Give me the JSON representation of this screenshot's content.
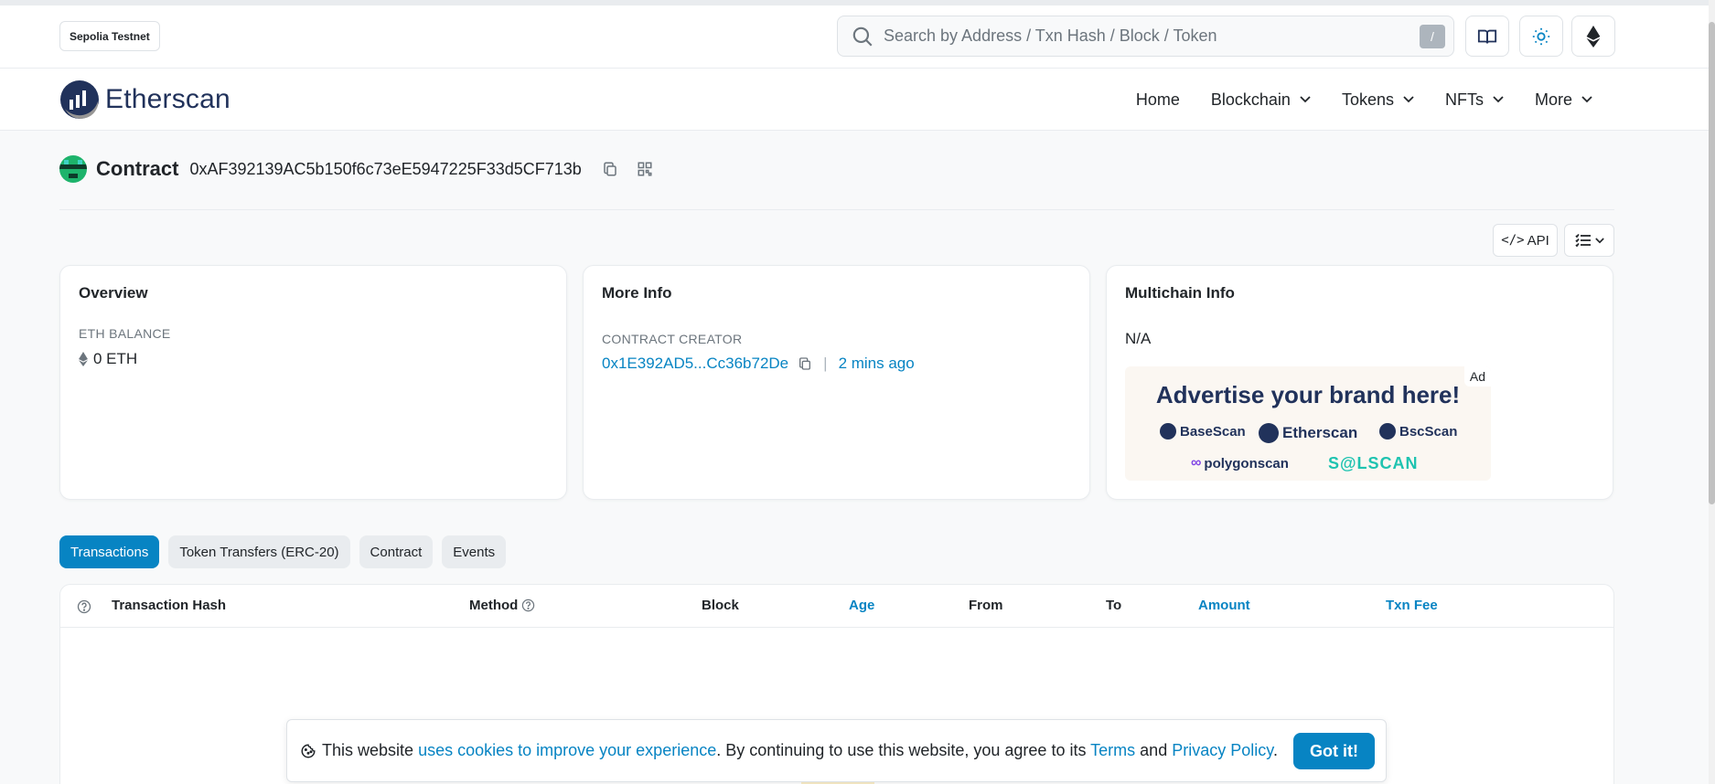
{
  "topbar": {
    "network": "Sepolia Testnet",
    "search_placeholder": "Search by Address / Txn Hash / Block / Token",
    "search_shortcut": "/"
  },
  "nav": {
    "logo_text": "Etherscan",
    "items": [
      {
        "label": "Home",
        "has_dropdown": false
      },
      {
        "label": "Blockchain",
        "has_dropdown": true
      },
      {
        "label": "Tokens",
        "has_dropdown": true
      },
      {
        "label": "NFTs",
        "has_dropdown": true
      },
      {
        "label": "More",
        "has_dropdown": true
      }
    ]
  },
  "contract": {
    "label": "Contract",
    "address": "0xAF392139AC5b150f6c73eE5947225F33d5CF713b"
  },
  "toolbar": {
    "api_label": "API"
  },
  "overview": {
    "title": "Overview",
    "balance_label": "ETH BALANCE",
    "balance_value": "0 ETH"
  },
  "more_info": {
    "title": "More Info",
    "creator_label": "CONTRACT CREATOR",
    "creator_address": "0x1E392AD5...Cc36b72De",
    "separator": "|",
    "created_ago": "2 mins ago"
  },
  "multichain": {
    "title": "Multichain Info",
    "value": "N/A",
    "ad_label": "Ad",
    "ad_headline": "Advertise your brand here!",
    "ad_brands": [
      "BaseScan",
      "Etherscan",
      "BscScan",
      "polygonscan",
      "S@LSCAN"
    ]
  },
  "tabs": [
    {
      "label": "Transactions",
      "active": true
    },
    {
      "label": "Token Transfers (ERC-20)",
      "active": false
    },
    {
      "label": "Contract",
      "active": false
    },
    {
      "label": "Events",
      "active": false
    }
  ],
  "table": {
    "columns": [
      "Transaction Hash",
      "Method",
      "Block",
      "Age",
      "From",
      "To",
      "Amount",
      "Txn Fee"
    ]
  },
  "cookie": {
    "text_before": "This website",
    "link_cookies": "uses cookies to improve your experience",
    "text_middle": ". By continuing to use this website, you agree to its",
    "link_terms": "Terms",
    "text_and": "and",
    "link_privacy": "Privacy Policy",
    "text_end": ".",
    "button_label": "Got it!"
  },
  "colors": {
    "accent": "#0784c3",
    "brand_dark": "#21325b"
  }
}
